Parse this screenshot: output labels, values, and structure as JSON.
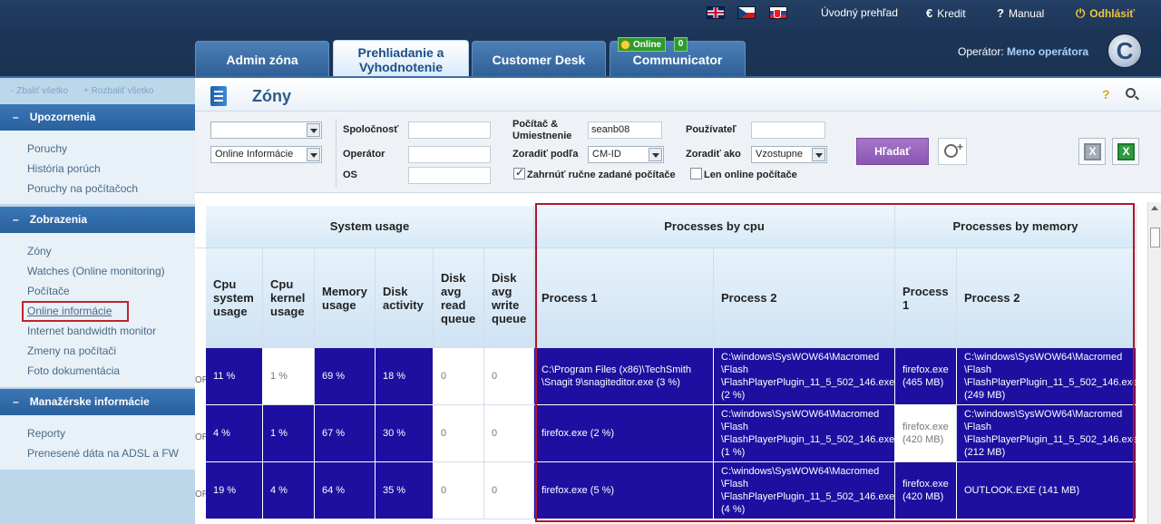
{
  "header": {
    "languages": [
      "english-flag",
      "czech-flag",
      "slovak-flag"
    ],
    "links": {
      "home": "Úvodný prehľad",
      "credit": "Kredit",
      "manual": "Manual",
      "logout": "Odhlásiť"
    },
    "tabs": [
      {
        "label": "Admin zóna"
      },
      {
        "label": "Prehliadanie a Vyhodnotenie"
      },
      {
        "label": "Customer Desk"
      },
      {
        "label": "Communicator"
      }
    ],
    "online_badge": "Online",
    "online_count": "0",
    "operator_label": "Operátor:",
    "operator_name": "Meno operátora",
    "logo_letter": "C"
  },
  "sidebar": {
    "collapse_all": "- Zbaliť všetko",
    "expand_all": "+ Rozbaliť všetko",
    "sections": [
      {
        "title": "Upozornenia",
        "items": [
          "Poruchy",
          "História porúch",
          "Poruchy na počítačoch"
        ]
      },
      {
        "title": "Zobrazenia",
        "items": [
          "Zóny",
          "Watches (Online monitoring)",
          "Počítače",
          "Online informácie",
          "Internet bandwidth monitor",
          "Zmeny na počítači",
          "Foto dokumentácia"
        ]
      },
      {
        "title": "Manažérske informácie",
        "items": [
          "Reporty",
          "Prenesené dáta na ADSL a FW"
        ]
      }
    ]
  },
  "page": {
    "title": "Zóny",
    "help": "?"
  },
  "filters": {
    "select1": "",
    "select2": "Online Informácie",
    "company_label": "Spoločnosť",
    "operator_label": "Operátor",
    "os_label": "OS",
    "computer_label_1": "Počítač &",
    "computer_label_2": "Umiestnenie",
    "computer_value": "seanb08",
    "sort_by_label": "Zoradiť podľa",
    "sort_by_value": "CM-ID",
    "user_label": "Používateľ",
    "sort_as_label": "Zoradiť ako",
    "sort_as_value": "Vzostupne",
    "include_manual_label": "Zahrnúť ručne zadané počítače",
    "online_only_label": "Len online počítače",
    "search_button": "Hľadať"
  },
  "grid": {
    "group_headers": {
      "system": "System usage",
      "cpu": "Processes by cpu",
      "memory": "Processes by memory"
    },
    "columns": {
      "cpu_system": "Cpu system usage",
      "cpu_kernel": "Cpu kernel usage",
      "memory": "Memory usage",
      "disk": "Disk activity",
      "read_queue": "Disk avg read queue",
      "write_queue": "Disk avg write queue",
      "cpu_p1": "Process 1",
      "cpu_p2": "Process 2",
      "mem_p1": "Process 1",
      "mem_p2": "Process 2"
    },
    "edge_marker": "OR",
    "rows": [
      {
        "cpu_system": "11 %",
        "cpu_kernel": "1 %",
        "memory": "69 %",
        "disk": "18 %",
        "read_queue": "0",
        "write_queue": "0",
        "cpu_p1": "C:\\Program Files (x86)\\TechSmith \\Snagit 9\\snagiteditor.exe (3 %)",
        "cpu_p2": "C:\\windows\\SysWOW64\\Macromed \\Flash \\FlashPlayerPlugin_11_5_502_146.exe (2 %)",
        "mem_p1": "firefox.exe (465 MB)",
        "mem_p2": "C:\\windows\\SysWOW64\\Macromed \\Flash \\FlashPlayerPlugin_11_5_502_146.exe (249 MB)"
      },
      {
        "cpu_system": "4 %",
        "cpu_kernel": "1 %",
        "memory": "67 %",
        "disk": "30 %",
        "read_queue": "0",
        "write_queue": "0",
        "cpu_p1": "firefox.exe (2 %)",
        "cpu_p2": "C:\\windows\\SysWOW64\\Macromed \\Flash \\FlashPlayerPlugin_11_5_502_146.exe (1 %)",
        "mem_p1": "firefox.exe (420 MB)",
        "mem_p2": "C:\\windows\\SysWOW64\\Macromed \\Flash \\FlashPlayerPlugin_11_5_502_146.exe (212 MB)"
      },
      {
        "cpu_system": "19 %",
        "cpu_kernel": "4 %",
        "memory": "64 %",
        "disk": "35 %",
        "read_queue": "0",
        "write_queue": "0",
        "cpu_p1": "firefox.exe (5 %)",
        "cpu_p2": "C:\\windows\\SysWOW64\\Macromed \\Flash \\FlashPlayerPlugin_11_5_502_146.exe (4 %)",
        "mem_p1": "firefox.exe (420 MB)",
        "mem_p2": "OUTLOOK.EXE (141 MB)"
      }
    ]
  },
  "colors": {
    "header_bg": "#1d3658",
    "tab_bg": "#2d5f96",
    "sidebar_head": "#2a609e",
    "highlight_cell": "#1f0fa0",
    "search_button": "#8b55b4",
    "alert_border": "#b2152a"
  }
}
